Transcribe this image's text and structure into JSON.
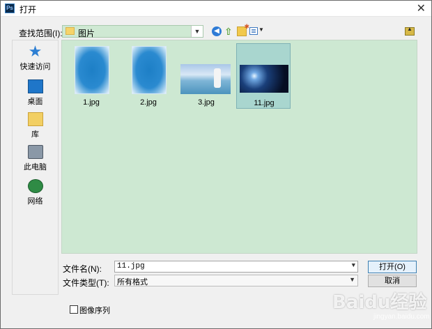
{
  "window": {
    "title": "打开",
    "app_badge": "Ps"
  },
  "toolbar": {
    "look_in_label": "查找范围(I):",
    "look_in_value": "图片"
  },
  "places": [
    {
      "label": "快速访问",
      "icon": "star-icon"
    },
    {
      "label": "桌面",
      "icon": "desktop-icon"
    },
    {
      "label": "库",
      "icon": "library-icon"
    },
    {
      "label": "此电脑",
      "icon": "computer-icon"
    },
    {
      "label": "网络",
      "icon": "network-icon"
    }
  ],
  "files": [
    {
      "name": "1.jpg",
      "thumb": "portrait",
      "selected": false
    },
    {
      "name": "2.jpg",
      "thumb": "portrait",
      "selected": false
    },
    {
      "name": "3.jpg",
      "thumb": "beach",
      "selected": false
    },
    {
      "name": "11.jpg",
      "thumb": "space",
      "selected": true
    }
  ],
  "form": {
    "file_name_label": "文件名(N):",
    "file_name_value": "11.jpg",
    "file_type_label": "文件类型(T):",
    "file_type_value": "所有格式",
    "open_label": "打开(O)",
    "cancel_label": "取消",
    "image_sequence_label": "图像序列"
  },
  "watermark": {
    "text": "Baidu经验",
    "sub": "jingyan.baidu.com"
  },
  "colors": {
    "file_area_bg": "#cde8d2",
    "selected_tile": "#a9d6cf",
    "accent": "#3c7fb1"
  }
}
